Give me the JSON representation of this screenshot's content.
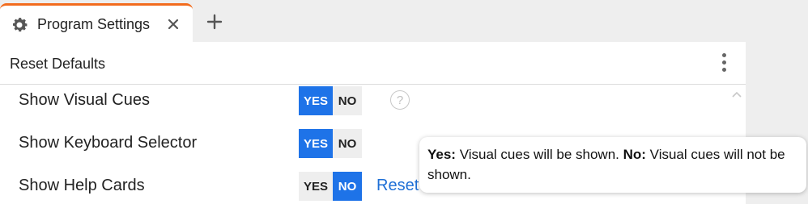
{
  "tab": {
    "title": "Program Settings",
    "icon": "gear-icon",
    "accent_color": "#f26b1d"
  },
  "toolbar": {
    "reset_defaults_label": "Reset Defaults"
  },
  "settings": [
    {
      "label": "Show Visual Cues",
      "yes": "YES",
      "no": "NO",
      "selected": "yes",
      "help": "?"
    },
    {
      "label": "Show Keyboard Selector",
      "yes": "YES",
      "no": "NO",
      "selected": "yes"
    },
    {
      "label": "Show Help Cards",
      "yes": "YES",
      "no": "NO",
      "selected": "no",
      "reset_label": "Reset"
    }
  ],
  "tooltip": {
    "yes_prefix": "Yes:",
    "yes_text": " Visual cues will be shown. ",
    "no_prefix": "No:",
    "no_text": " Visual cues will not be shown."
  },
  "colors": {
    "selected": "#1e73e8",
    "link": "#1e6fd6"
  }
}
